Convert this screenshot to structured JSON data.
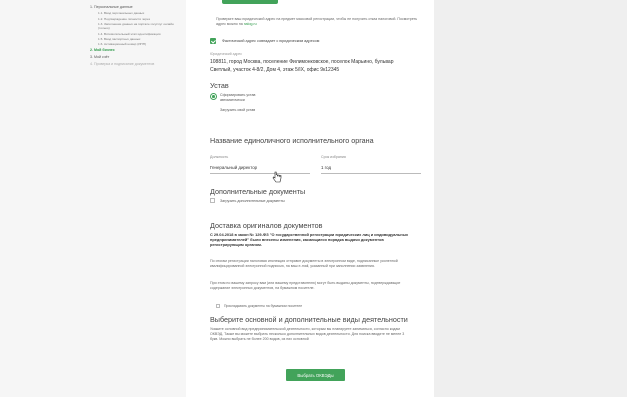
{
  "sidebar": {
    "items": [
      {
        "kind": "main",
        "label": "1. Персональные данные"
      },
      {
        "kind": "sub",
        "label": "1.1. Ввод персональных данных"
      },
      {
        "kind": "sub",
        "label": "1.2. Подтверждение личности через"
      },
      {
        "kind": "sub",
        "label": "1.3. Заполнение данных на портале госуслуг онлайн (только)"
      },
      {
        "kind": "sub",
        "label": "1.4. Вспомогательный этап идентификации"
      },
      {
        "kind": "sub",
        "label": "1.5. Ввод паспортных данных"
      },
      {
        "kind": "sub",
        "label": "1.6. Активационный номер (ИНН)"
      },
      {
        "kind": "active",
        "label": "2. Мой бизнес"
      },
      {
        "kind": "main",
        "label": "3. Мой счёт"
      },
      {
        "kind": "disabled",
        "label": "4. Проверка и подписание документов"
      }
    ]
  },
  "top_note": {
    "text": "Проверьте ваш юридический адрес на предмет массовой регистрации, чтобы не получить отказ налоговой. Посмотреть адрес можно на",
    "link": "nalog.ru"
  },
  "fact_address_checkbox": {
    "label": "Фактический адрес совпадает с юридическим адресом",
    "checked": true
  },
  "address": {
    "label": "Юридический адрес",
    "value": "108811, город Москва, поселение Филимонковское, поселок Марьино, бульвар Светлый, участок 4-8/2, Дом 4, этаж 5/IX, офис 9к12345"
  },
  "ustav": {
    "heading": "Устав",
    "options": [
      {
        "label": "Сформировать устав автоматически",
        "selected": true
      },
      {
        "label": "Загрузить свой устав",
        "selected": false
      }
    ]
  },
  "executive": {
    "heading": "Название единоличного исполнительного органа",
    "position_label": "Должность",
    "position_value": "Генеральный директор",
    "term_label": "Срок избрания",
    "term_value": "1 год"
  },
  "extra_docs": {
    "heading": "Дополнительные документы",
    "upload_label": "Загрузить дополнительные документы"
  },
  "delivery": {
    "heading": "Доставка оригиналов документов",
    "law_text": "С 29.04.2018 в закон № 129-ФЗ \"О государственной регистрации юридических лиц и индивидуальных предпринимателей\" были внесены изменения, касающиеся порядка выдачи документов регистрирующим органом.",
    "para1": "По итогам регистрации налоговая инспекция отправит документы в электронном виде, подписанные усиленной квалифицированной электронной подписью, на ваш e-mail, указанный при заполнении заявления.",
    "para2": "При этом по вашему запросу вам (или вашему представителю) могут быть выданы документы, подтверждающие содержание электронных документов, на бумажном носителе.",
    "paper_checkbox_label": "Прикладывать документы на бумажном носителе"
  },
  "okved": {
    "heading": "Выберите основной и дополнительные виды деятельности",
    "text": "Укажите основной вид предпринимательской деятельности, которым вы планируете заниматься, согласно кодам ОКВЭД. Также вы можете выбрать несколько дополнительных видов деятельности. Для поиска вводите не менее 3 букв. Можно выбрать не более 200 видов, из них основной",
    "button_label": "Выбрать ОКВЭДы"
  },
  "colors": {
    "accent": "#42a35a",
    "page_bg": "#e7e7e7",
    "panel_bg": "#ffffff"
  }
}
